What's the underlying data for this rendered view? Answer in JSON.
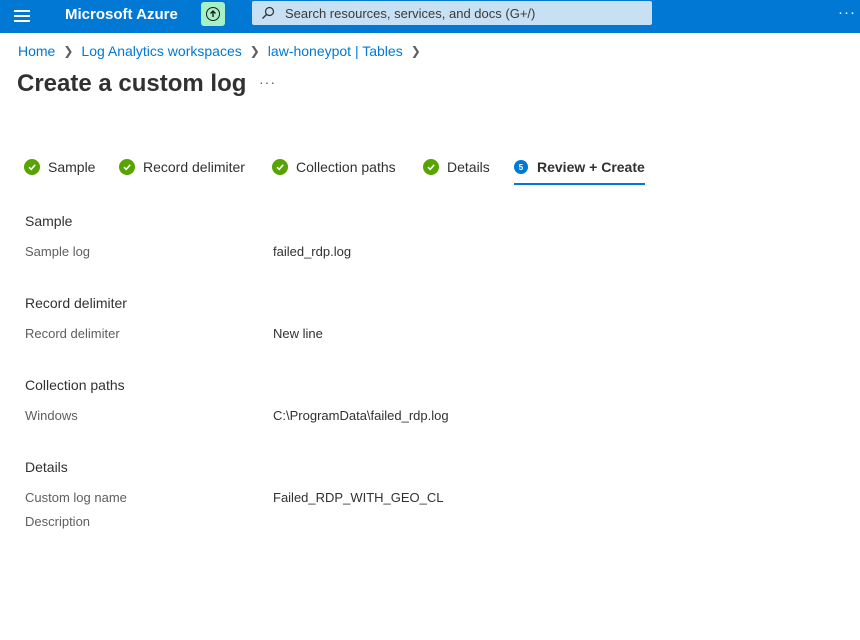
{
  "topbar": {
    "brand": "Microsoft Azure",
    "search_placeholder": "Search resources, services, and docs (G+/)",
    "more": "···",
    "accent_color": "#0078d4"
  },
  "breadcrumb": {
    "items": [
      "Home",
      "Log Analytics workspaces",
      "law-honeypot | Tables"
    ]
  },
  "page": {
    "title": "Create a custom log",
    "more": "···"
  },
  "tabs": [
    {
      "label": "Sample",
      "state": "complete"
    },
    {
      "label": "Record delimiter",
      "state": "complete"
    },
    {
      "label": "Collection paths",
      "state": "complete"
    },
    {
      "label": "Details",
      "state": "complete"
    },
    {
      "label": "Review + Create",
      "state": "active",
      "number": "5"
    }
  ],
  "review": {
    "sample": {
      "title": "Sample",
      "label": "Sample log",
      "value": "failed_rdp.log"
    },
    "record_delimiter": {
      "title": "Record delimiter",
      "label": "Record delimiter",
      "value": "New line"
    },
    "collection_paths": {
      "title": "Collection paths",
      "label": "Windows",
      "value": "C:\\ProgramData\\failed_rdp.log"
    },
    "details": {
      "title": "Details",
      "name_label": "Custom log name",
      "name_value": "Failed_RDP_WITH_GEO_CL",
      "description_label": "Description"
    }
  }
}
